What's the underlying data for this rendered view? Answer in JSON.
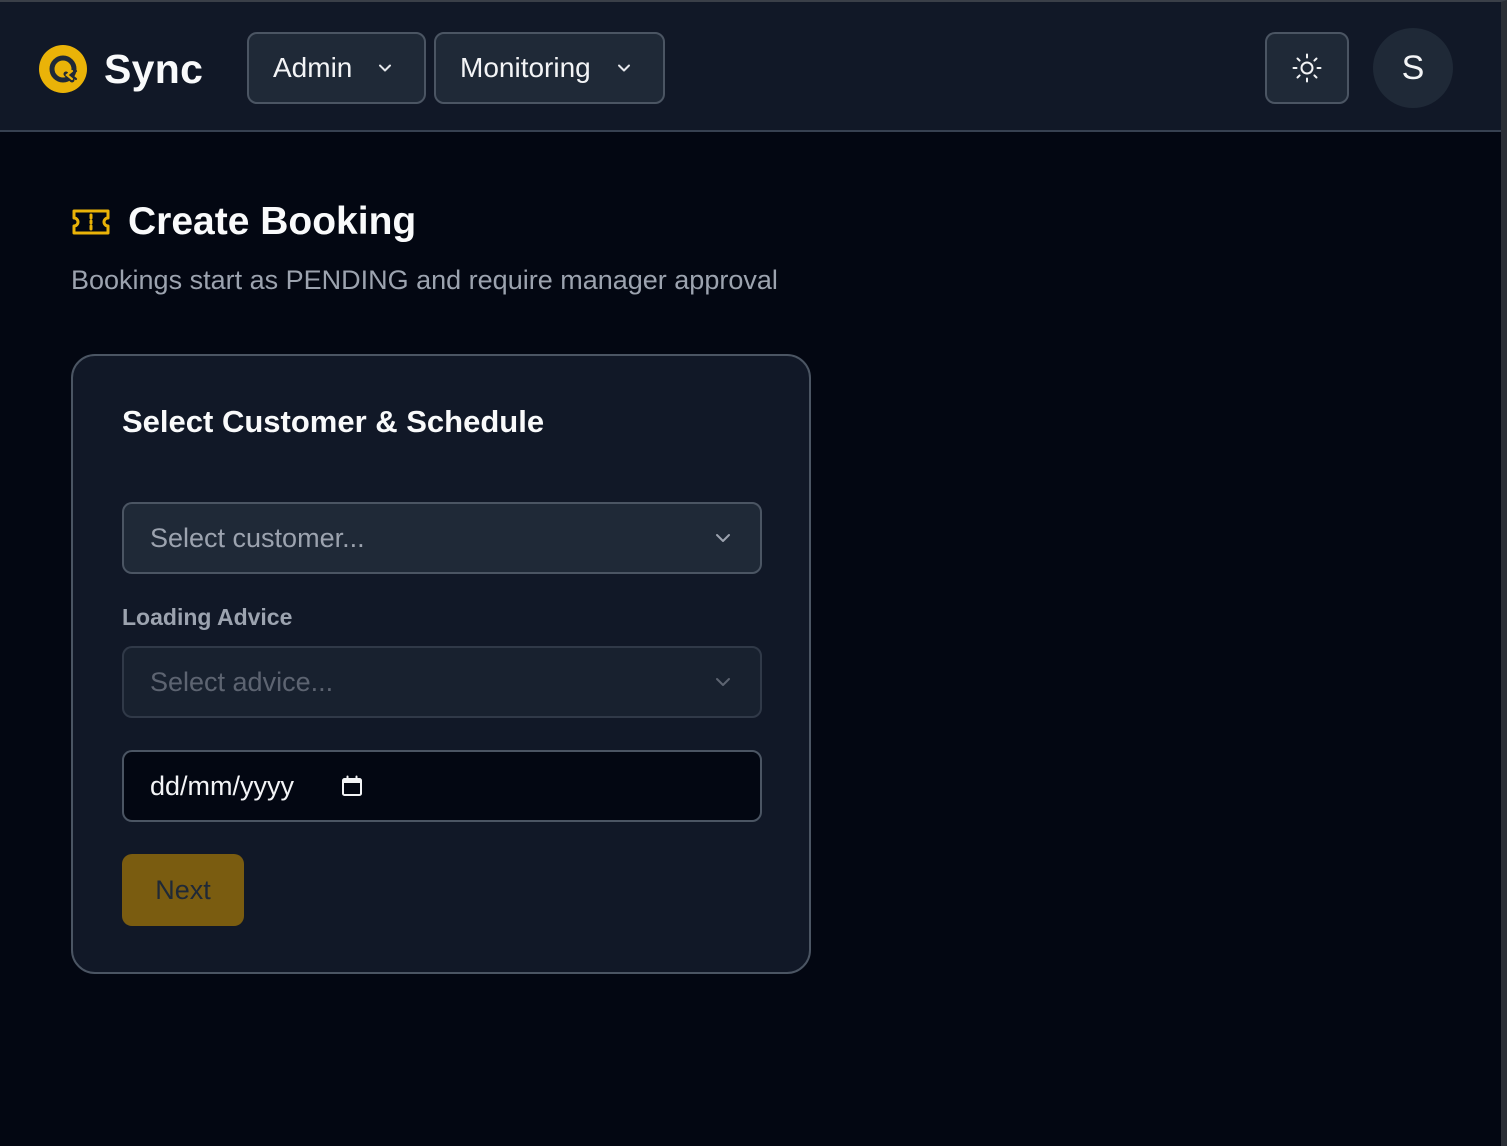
{
  "app": {
    "name": "Sync",
    "accent": "#eab308"
  },
  "nav": {
    "items": [
      {
        "label": "Admin"
      },
      {
        "label": "Monitoring"
      }
    ]
  },
  "user": {
    "initial": "S"
  },
  "page": {
    "title": "Create Booking",
    "subtitle": "Bookings start as PENDING and require manager approval"
  },
  "form": {
    "section_title": "Select Customer & Schedule",
    "customer_select": {
      "placeholder": "Select customer..."
    },
    "loading_advice": {
      "label": "Loading Advice",
      "placeholder": "Select advice...",
      "disabled": true
    },
    "date": {
      "placeholder": "dd/mm/yyyy"
    },
    "next_label": "Next"
  }
}
